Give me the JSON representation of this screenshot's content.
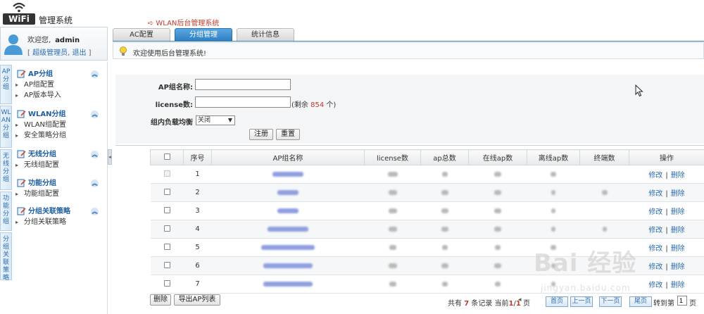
{
  "header": {
    "logo_text": "WiFi",
    "system_title": "管理系统",
    "breadcrumb": "WLAN后台管理系统"
  },
  "user_panel": {
    "welcome": "欢迎您,",
    "username": "admin",
    "bracket_open": "[",
    "role": "超级管理员,",
    "logout": "退出",
    "bracket_close": "]"
  },
  "tabs": [
    {
      "label": "AC配置",
      "active": false
    },
    {
      "label": "分组管理",
      "active": true
    },
    {
      "label": "统计信息",
      "active": false
    }
  ],
  "notice": "欢迎使用后台管理系统!",
  "left_nav": {
    "vertical_tabs": [
      "AP分组",
      "WLAN分组",
      "无线分组",
      "功能分组",
      "分组关联策略"
    ],
    "groups": [
      {
        "title": "AP分组",
        "items": [
          "AP组配置",
          "AP版本导入"
        ]
      },
      {
        "title": "WLAN分组",
        "items": [
          "WLAN组配置",
          "安全策略分组"
        ]
      },
      {
        "title": "无线分组",
        "items": [
          "无线组配置"
        ]
      },
      {
        "title": "功能分组",
        "items": [
          "功能组配置"
        ]
      },
      {
        "title": "分组关联策略",
        "items": [
          "分组关联策略"
        ]
      }
    ]
  },
  "form": {
    "ap_group_label": "AP组名称:",
    "ap_group_value": "",
    "license_label": "license数:",
    "license_value": "",
    "remain_prefix": "(剩余",
    "remain_count": "854",
    "remain_suffix": "个)",
    "lb_label": "组内负载均衡",
    "lb_value": "关闭",
    "register_button": "注册",
    "reset_button": "重置"
  },
  "table": {
    "headers": [
      "序号",
      "AP组名称",
      "license数",
      "ap总数",
      "在线ap数",
      "离线ap数",
      "终端数",
      "操作"
    ],
    "edit_label": "修改",
    "separator": "|",
    "delete_label": "删除",
    "rows": [
      {
        "index": "1"
      },
      {
        "index": "2"
      },
      {
        "index": "3"
      },
      {
        "index": "4"
      },
      {
        "index": "5"
      },
      {
        "index": "6"
      },
      {
        "index": "7"
      }
    ]
  },
  "footer": {
    "delete_button": "删除",
    "export_button": "导出AP列表",
    "total_prefix": "共有",
    "total_count": "7",
    "total_suffix": "条记录",
    "current_prefix": "当前",
    "current_page": "1",
    "page_sep": "/",
    "total_pages": "1",
    "page_unit": "页",
    "first_page": "首页",
    "prev_page": "上一页",
    "next_page": "下一页",
    "last_page": "尾页",
    "goto_prefix": "转到第",
    "goto_value": "1",
    "goto_suffix": "页"
  },
  "watermark": {
    "main": "Bai 经验",
    "sub": "jingyan.baidu.com"
  },
  "colors": {
    "accent_blue": "#2f7fc1",
    "link_blue": "#2b6cb0",
    "highlight_red": "#c0392b"
  }
}
